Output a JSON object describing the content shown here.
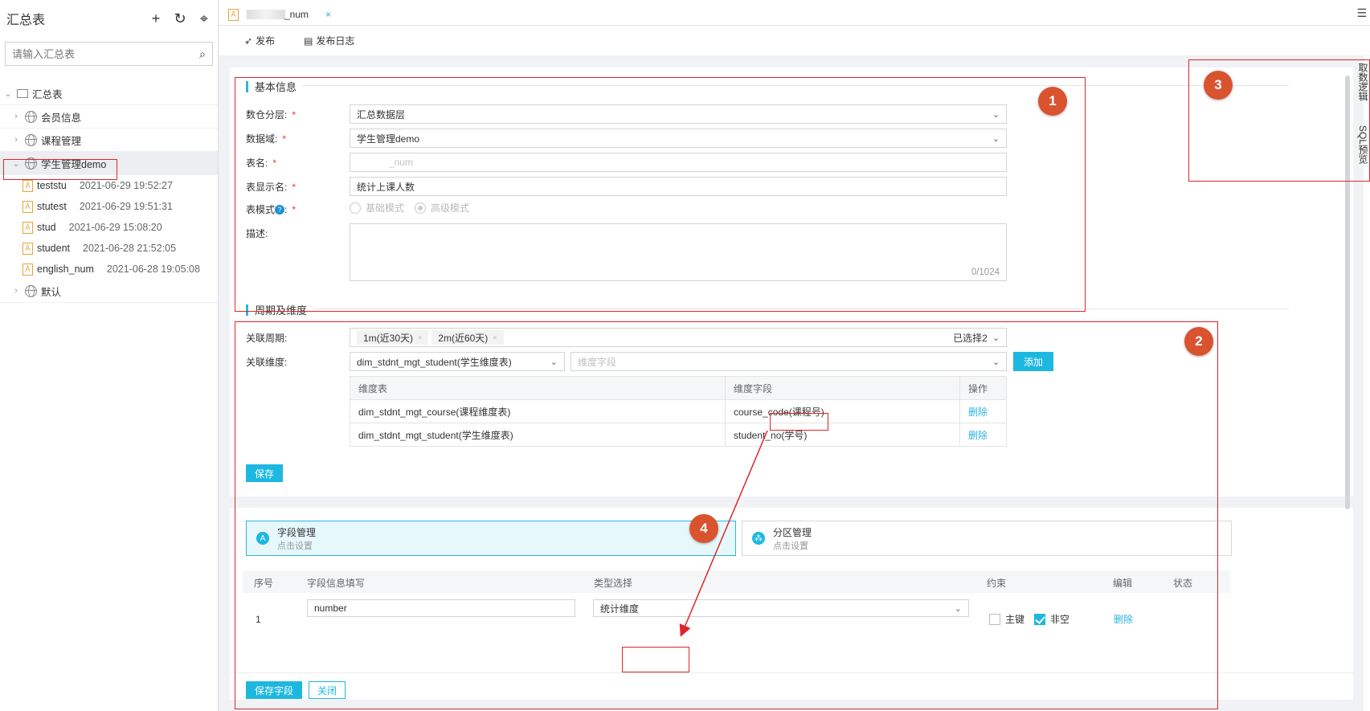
{
  "sidebar": {
    "title": "汇总表",
    "search_placeholder": "请输入汇总表",
    "root": "汇总表",
    "groups": [
      "会员信息",
      "课程管理",
      "学生管理demo"
    ],
    "default_group": "默认",
    "tables": [
      {
        "name": "teststu",
        "time": "2021-06-29 19:52:27"
      },
      {
        "name": "stutest",
        "time": "2021-06-29 19:51:31"
      },
      {
        "name": "stud",
        "time": "2021-06-29 15:08:20"
      },
      {
        "name": "student",
        "time": "2021-06-28 21:52:05"
      },
      {
        "name": "english_num",
        "time": "2021-06-28 19:05:08"
      }
    ]
  },
  "tab": {
    "label": "_num",
    "close": "×"
  },
  "toolbar": {
    "publish": "发布",
    "publish_log": "发布日志"
  },
  "basic": {
    "title": "基本信息",
    "layer_label": "数仓分层:",
    "layer_value": "汇总数据层",
    "domain_label": "数据域:",
    "domain_value": "学生管理demo",
    "tablename_label": "表名:",
    "tablename_value": "_num",
    "display_label": "表显示名:",
    "display_value": "统计上课人数",
    "mode_label": "表模式",
    "mode_colon": ":",
    "mode_basic": "基础模式",
    "mode_advanced": "高级模式",
    "desc_label": "描述:",
    "desc_counter": "0/1024",
    "required": "*"
  },
  "period": {
    "title": "周期及维度",
    "period_label": "关联周期:",
    "period_tags": [
      "1m(近30天)",
      "2m(近60天)"
    ],
    "period_selected": "已选择2",
    "dim_label": "关联维度:",
    "dim_value": "dim_stdnt_mgt_student(学生维度表)",
    "dim_field_placeholder": "维度字段",
    "add_button": "添加",
    "table_headers": [
      "维度表",
      "维度字段",
      "操作"
    ],
    "rows": [
      {
        "table": "dim_stdnt_mgt_course(课程维度表)",
        "field": "course_code(课程号)",
        "op": "删除"
      },
      {
        "table": "dim_stdnt_mgt_student(学生维度表)",
        "field": "student_no(学号)",
        "op": "删除"
      }
    ],
    "save_button": "保存"
  },
  "fields": {
    "card_field_title": "字段管理",
    "card_field_sub": "点击设置",
    "card_partition_title": "分区管理",
    "card_partition_sub": "点击设置",
    "headers": [
      "序号",
      "字段信息填写",
      "类型选择",
      "约束",
      "编辑",
      "状态"
    ],
    "row_index": "1",
    "row_name": "number",
    "row_type": "统计维度",
    "pk_label": "主键",
    "notnull_label": "非空",
    "delete": "删除",
    "save_fields": "保存字段",
    "close": "关闭"
  },
  "right_tabs": [
    "取数逻辑",
    "SQL预览"
  ],
  "badges": [
    "1",
    "2",
    "3",
    "4"
  ],
  "colors": {
    "accent": "#1cb8e0",
    "annotation": "#e0242b",
    "badge": "#d9532f"
  }
}
